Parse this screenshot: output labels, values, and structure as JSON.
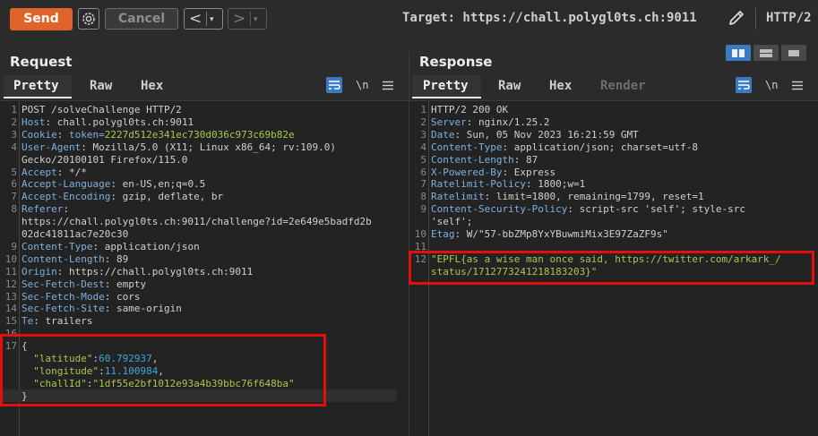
{
  "toolbar": {
    "send_label": "Send",
    "cancel_label": "Cancel",
    "back_glyph": "<",
    "forward_glyph": ">",
    "dropdown_glyph": "▾",
    "target_label": "Target: https://chall.polygl0ts.ch:9011",
    "http_version": "HTTP/2",
    "icons": [
      "gear-icon",
      "pencil-icon"
    ]
  },
  "layout_toggle": {
    "selected": "side-by-side",
    "icons": [
      "split-vertical-icon",
      "split-horizontal-icon",
      "single-pane-icon"
    ],
    "accent": "#3d7ac4"
  },
  "request": {
    "title": "Request",
    "tabs": [
      "Pretty",
      "Raw",
      "Hex"
    ],
    "active_tab": "Pretty",
    "newline_label": "\\n",
    "lines": [
      {
        "n": "1",
        "text": "POST /solveChallenge HTTP/2"
      },
      {
        "n": "2",
        "name": "Host",
        "value": "chall.polygl0ts.ch:9011"
      },
      {
        "n": "3",
        "name": "Cookie",
        "pre": "token=",
        "value": "2227d512e341ec730d036c973c69b82e"
      },
      {
        "n": "4",
        "name": "User-Agent",
        "value": "Mozilla/5.0 (X11; Linux x86_64; rv:109.0)"
      },
      {
        "n": "",
        "text": "Gecko/20100101 Firefox/115.0"
      },
      {
        "n": "5",
        "name": "Accept",
        "value": "*/*"
      },
      {
        "n": "6",
        "name": "Accept-Language",
        "value": "en-US,en;q=0.5"
      },
      {
        "n": "7",
        "name": "Accept-Encoding",
        "value": "gzip, deflate, br"
      },
      {
        "n": "8",
        "name": "Referer",
        "value": ""
      },
      {
        "n": "",
        "text": "https://chall.polygl0ts.ch:9011/challenge?id=2e649e5badfd2b"
      },
      {
        "n": "",
        "text": "02dc41811ac7e20c30"
      },
      {
        "n": "9",
        "name": "Content-Type",
        "value": "application/json"
      },
      {
        "n": "10",
        "name": "Content-Length",
        "value": "89"
      },
      {
        "n": "11",
        "name": "Origin",
        "value": "https://chall.polygl0ts.ch:9011"
      },
      {
        "n": "12",
        "name": "Sec-Fetch-Dest",
        "value": "empty"
      },
      {
        "n": "13",
        "name": "Sec-Fetch-Mode",
        "value": "cors"
      },
      {
        "n": "14",
        "name": "Sec-Fetch-Site",
        "value": "same-origin"
      },
      {
        "n": "15",
        "name": "Te",
        "value": "trailers"
      },
      {
        "n": "16",
        "text": ""
      },
      {
        "n": "17",
        "text": "{"
      },
      {
        "n": "",
        "key": "\"latitude\"",
        "num": "60.792937",
        "tail": ","
      },
      {
        "n": "",
        "key": "\"longitude\"",
        "num": "11.100984",
        "tail": ","
      },
      {
        "n": "",
        "key": "\"challId\"",
        "str": "\"1df55e2bf1012e93a4b39bbc76f648ba\""
      },
      {
        "n": "",
        "text": "}"
      }
    ]
  },
  "response": {
    "title": "Response",
    "tabs": [
      "Pretty",
      "Raw",
      "Hex",
      "Render"
    ],
    "active_tab": "Pretty",
    "newline_label": "\\n",
    "lines": [
      {
        "n": "1",
        "text": "HTTP/2 200 OK"
      },
      {
        "n": "2",
        "name": "Server",
        "value": "nginx/1.25.2"
      },
      {
        "n": "3",
        "name": "Date",
        "value": "Sun, 05 Nov 2023 16:21:59 GMT"
      },
      {
        "n": "4",
        "name": "Content-Type",
        "value": "application/json; charset=utf-8"
      },
      {
        "n": "5",
        "name": "Content-Length",
        "value": "87"
      },
      {
        "n": "6",
        "name": "X-Powered-By",
        "value": "Express"
      },
      {
        "n": "7",
        "name": "Ratelimit-Policy",
        "value": "1800;w=1"
      },
      {
        "n": "8",
        "name": "Ratelimit",
        "value": "limit=1800, remaining=1799, reset=1"
      },
      {
        "n": "9",
        "name": "Content-Security-Policy",
        "value": "script-src 'self'; style-src"
      },
      {
        "n": "",
        "text": "'self';"
      },
      {
        "n": "10",
        "name": "Etag",
        "value": "W/\"57-bbZMp8YxYBuwmiMix3E97ZaZF9s\""
      },
      {
        "n": "11",
        "text": ""
      },
      {
        "n": "12",
        "str": "\"EPFL{as a wise man once said, https://twitter.com/arkark_/"
      },
      {
        "n": "",
        "str": "status/1712773241218183203}\""
      }
    ]
  },
  "colors": {
    "send": "#e0632a",
    "highlight": "#e01010",
    "header_name": "#7db0e0",
    "string": "#a7c84f",
    "number": "#3fa7d8"
  }
}
